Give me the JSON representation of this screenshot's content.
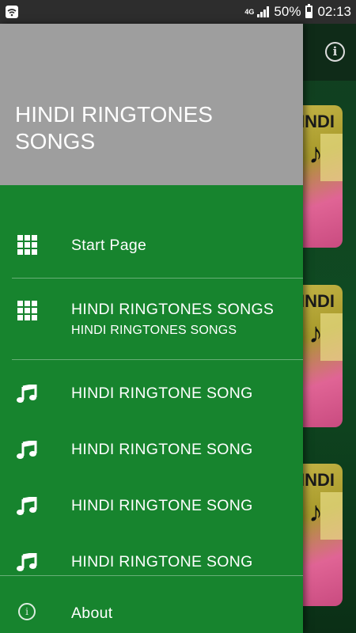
{
  "status_bar": {
    "network": "4G",
    "battery": "50%",
    "time": "02:13",
    "icons": [
      "wifi-icon",
      "signal-icon",
      "battery-icon"
    ]
  },
  "drawer": {
    "title": "HINDI RINGTONES SONGS",
    "items": [
      {
        "label": "Start Page",
        "icon": "grid-icon"
      },
      {
        "label": "HINDI RINGTONES SONGS",
        "sublabel": "HINDI RINGTONES SONGS",
        "icon": "grid-icon"
      },
      {
        "label": "HINDI RINGTONE SONG",
        "icon": "music-note-icon"
      },
      {
        "label": "HINDI RINGTONE SONG",
        "icon": "music-note-icon"
      },
      {
        "label": "HINDI RINGTONE SONG",
        "icon": "music-note-icon"
      },
      {
        "label": "HINDI RINGTONE SONG",
        "icon": "music-note-icon"
      }
    ],
    "about": {
      "label": "About",
      "icon": "info-icon"
    }
  },
  "background_app": {
    "card_tag": "INDI",
    "toolbar_icon": "info-icon"
  },
  "colors": {
    "drawer_bg": "#17842e",
    "header_bg": "#9e9e9e",
    "status_bar_bg": "#2d2d2d"
  }
}
